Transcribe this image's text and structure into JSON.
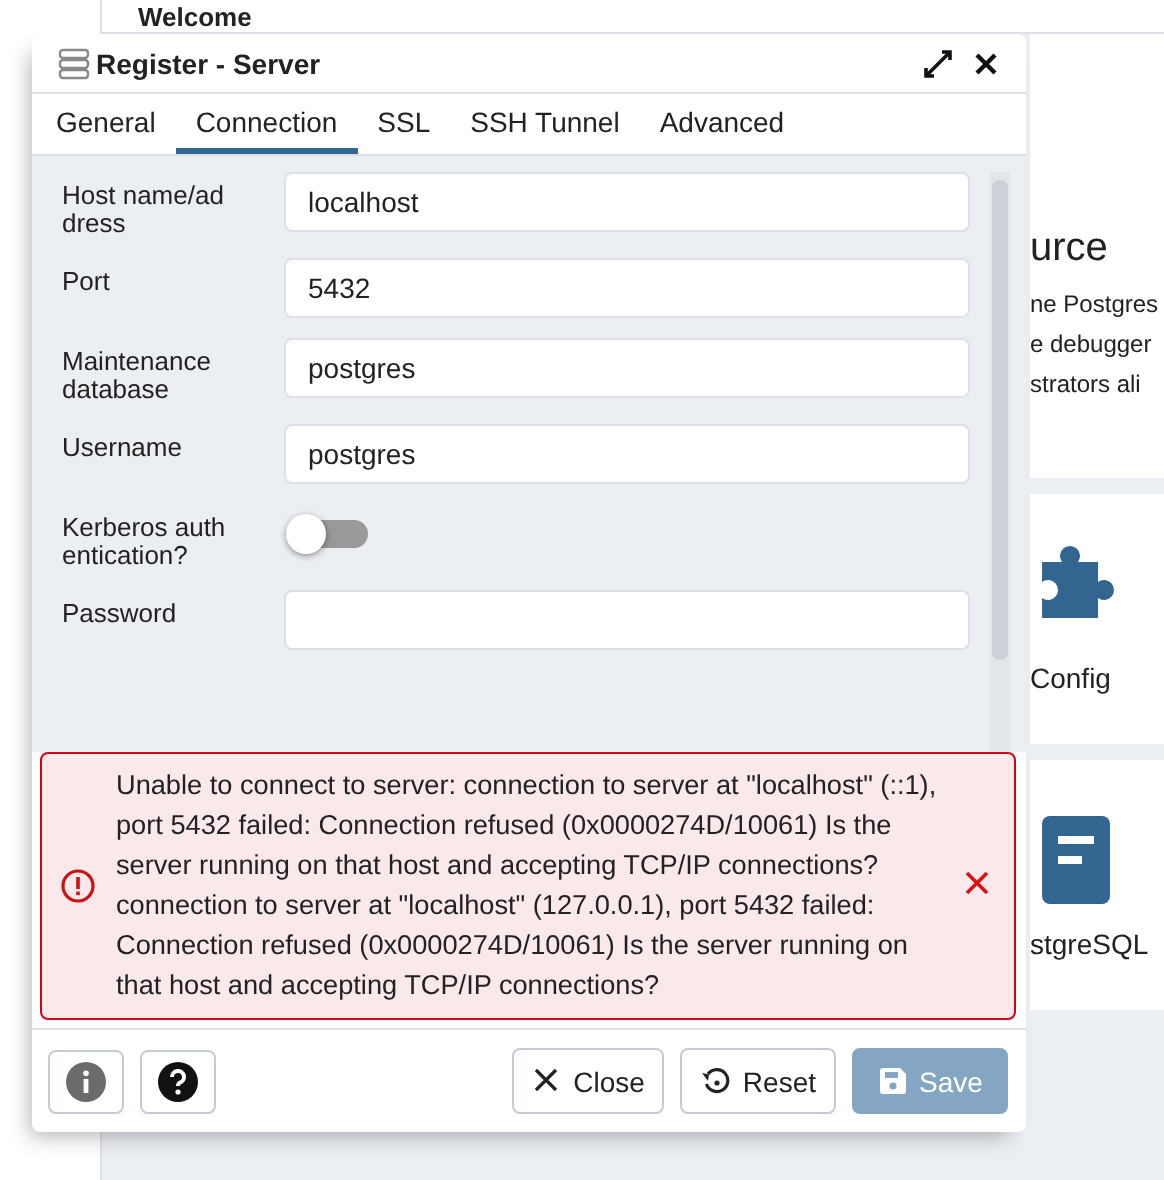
{
  "background": {
    "header": "Welcome",
    "heading": "urce",
    "lines": [
      "ne Postgres",
      "e debugger",
      "strators ali"
    ],
    "cards": [
      {
        "label": "Config"
      },
      {
        "label": "stgreSQL"
      }
    ]
  },
  "dialog": {
    "title": "Register - Server",
    "tabs": [
      {
        "label": "General",
        "selected": false
      },
      {
        "label": "Connection",
        "selected": true
      },
      {
        "label": "SSL",
        "selected": false
      },
      {
        "label": "SSH Tunnel",
        "selected": false
      },
      {
        "label": "Advanced",
        "selected": false
      }
    ],
    "fields": [
      {
        "kind": "text",
        "label": "Host name/address",
        "value": "localhost"
      },
      {
        "kind": "text",
        "label": "Port",
        "value": "5432"
      },
      {
        "kind": "text",
        "label": "Maintenance database",
        "value": "postgres"
      },
      {
        "kind": "text",
        "label": "Username",
        "value": "postgres"
      },
      {
        "kind": "toggle",
        "label": "Kerberos authentication?",
        "on": false
      },
      {
        "kind": "password",
        "label": "Password"
      }
    ],
    "error": "Unable to connect to server: connection to server at \"localhost\" (::1), port 5432 failed: Connection refused (0x0000274D/10061) Is the server running on that host and accepting TCP/IP connections? connection to server at \"localhost\" (127.0.0.1), port 5432 failed: Connection refused (0x0000274D/10061) Is the server running on that host and accepting TCP/IP connections?",
    "buttons": [
      {
        "kind": "close",
        "label": "Close",
        "disabled": false
      },
      {
        "kind": "reset",
        "label": "Reset",
        "disabled": false
      },
      {
        "kind": "save",
        "label": "Save",
        "disabled": true
      }
    ]
  }
}
